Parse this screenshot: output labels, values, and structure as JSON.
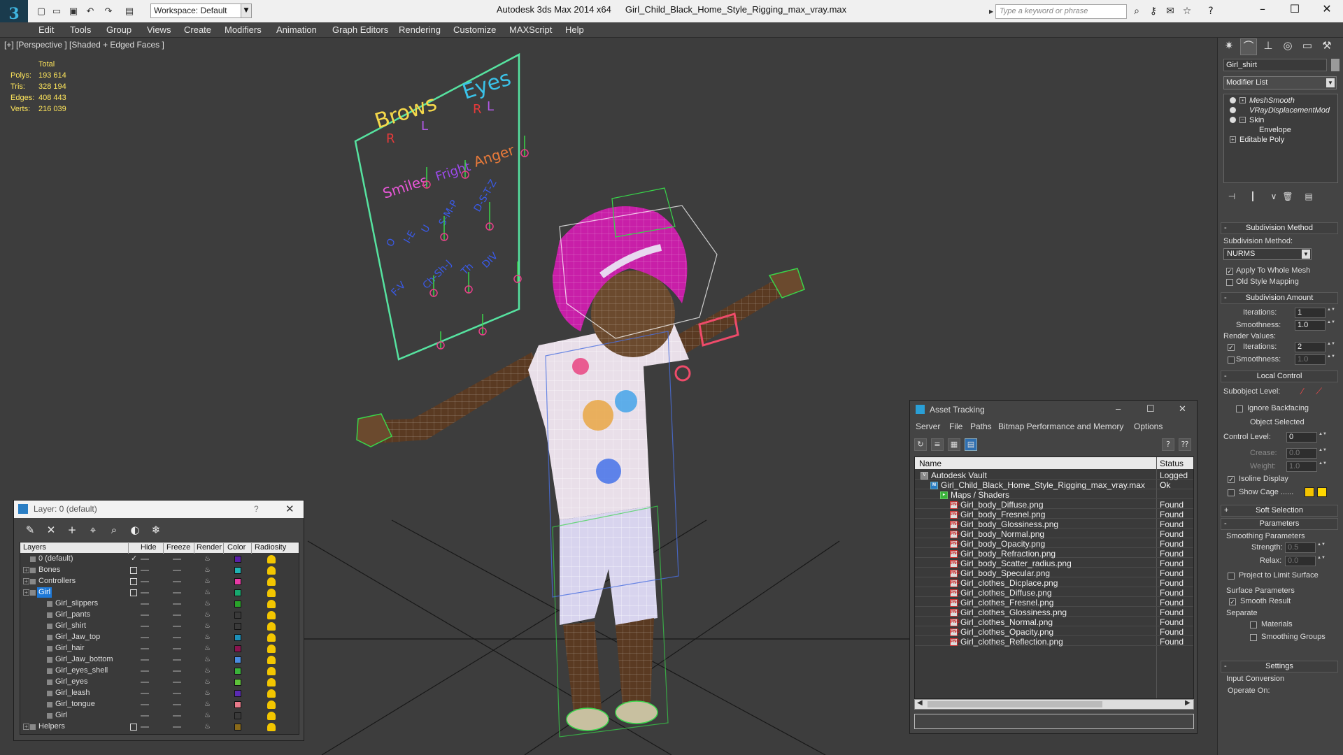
{
  "titlebar": {
    "workspace": "Workspace: Default",
    "app_name": "Autodesk 3ds Max  2014 x64",
    "file_name": "Girl_Child_Black_Home_Style_Rigging_max_vray.max",
    "search_placeholder": "Type a keyword or phrase"
  },
  "menu": [
    "Edit",
    "Tools",
    "Group",
    "Views",
    "Create",
    "Modifiers",
    "Animation",
    "Graph Editors",
    "Rendering",
    "Customize",
    "MAXScript",
    "Help"
  ],
  "viewport": {
    "label": "[+] [Perspective ] [Shaded + Edged Faces ]",
    "stats": {
      "header": "Total",
      "rows": [
        {
          "k": "Polys:",
          "v": "193 614"
        },
        {
          "k": "Tris:",
          "v": "328 194"
        },
        {
          "k": "Edges:",
          "v": "408 443"
        },
        {
          "k": "Verts:",
          "v": "216 039"
        }
      ]
    },
    "face_panel": {
      "brows": "Brows",
      "eyes": "Eyes",
      "r1": "R",
      "l1": "L",
      "r2": "R",
      "l2": "L",
      "smiles": "Smiles",
      "fright": "Fright",
      "anger": "Anger",
      "visemes": [
        "O",
        "I-E",
        "U",
        "S-M-P",
        "D-S-T-Z"
      ],
      "visemes2": [
        "F-V",
        "Ch-Sh-J",
        "Th",
        "DIV"
      ]
    },
    "colors": {
      "stats": "#ffe65c",
      "panel_frame": "#56e3a0",
      "hair": "#c81fa8",
      "wire_green": "#38d64a",
      "wire_blue": "#4a6fe0",
      "pink_ctrl": "#ef4b6a"
    }
  },
  "layer_window": {
    "title": "Layer: 0 (default)",
    "help": "?",
    "columns": [
      "Layers",
      "Hide",
      "Freeze",
      "Render",
      "Color",
      "Radiosity"
    ],
    "rows": [
      {
        "name": "0 (default)",
        "indent": 0,
        "expand": false,
        "check": true,
        "color": "#5a1fa8"
      },
      {
        "name": "Bones",
        "indent": 0,
        "expand": true,
        "color": "#1fb3b3"
      },
      {
        "name": "Controllers",
        "indent": 0,
        "expand": true,
        "color": "#e83aa5"
      },
      {
        "name": "Girl",
        "indent": 0,
        "expand": true,
        "selected": true,
        "color": "#17a86f"
      },
      {
        "name": "Girl_slippers",
        "indent": 1,
        "color": "#2aa32a"
      },
      {
        "name": "Girl_pants",
        "indent": 1,
        "color": "#3a3a3a"
      },
      {
        "name": "Girl_shirt",
        "indent": 1,
        "color": "#3a3a3a"
      },
      {
        "name": "Girl_Jaw_top",
        "indent": 1,
        "color": "#1c8fb8"
      },
      {
        "name": "Girl_hair",
        "indent": 1,
        "color": "#8a1450"
      },
      {
        "name": "Girl_Jaw_bottom",
        "indent": 1,
        "color": "#4a8ce0"
      },
      {
        "name": "Girl_eyes_shell",
        "indent": 1,
        "color": "#3ab33a"
      },
      {
        "name": "Girl_eyes",
        "indent": 1,
        "color": "#5ec23a"
      },
      {
        "name": "Girl_leash",
        "indent": 1,
        "color": "#5a2ab3"
      },
      {
        "name": "Girl_tongue",
        "indent": 1,
        "color": "#e87a8a"
      },
      {
        "name": "Girl",
        "indent": 1,
        "color": "#3a3a3a"
      },
      {
        "name": "Helpers",
        "indent": 0,
        "expand": true,
        "color": "#8a6a1a"
      }
    ]
  },
  "asset_window": {
    "title": "Asset Tracking",
    "menu": [
      "Server",
      "File",
      "Paths",
      "Bitmap Performance and Memory",
      "Options"
    ],
    "columns": [
      "Name",
      "Status"
    ],
    "rows": [
      {
        "name": "Autodesk Vault",
        "status": "Logged O",
        "level": 0,
        "type": "vault"
      },
      {
        "name": "Girl_Child_Black_Home_Style_Rigging_max_vray.max",
        "status": "Ok",
        "level": 1,
        "type": "max"
      },
      {
        "name": "Maps / Shaders",
        "status": "",
        "level": 2,
        "type": "folder"
      },
      {
        "name": "Girl_body_Diffuse.png",
        "status": "Found",
        "level": 3,
        "type": "png"
      },
      {
        "name": "Girl_body_Fresnel.png",
        "status": "Found",
        "level": 3,
        "type": "png"
      },
      {
        "name": "Girl_body_Glossiness.png",
        "status": "Found",
        "level": 3,
        "type": "png"
      },
      {
        "name": "Girl_body_Normal.png",
        "status": "Found",
        "level": 3,
        "type": "png"
      },
      {
        "name": "Girl_body_Opacity.png",
        "status": "Found",
        "level": 3,
        "type": "png"
      },
      {
        "name": "Girl_body_Refraction.png",
        "status": "Found",
        "level": 3,
        "type": "png"
      },
      {
        "name": "Girl_body_Scatter_radius.png",
        "status": "Found",
        "level": 3,
        "type": "png"
      },
      {
        "name": "Girl_body_Specular.png",
        "status": "Found",
        "level": 3,
        "type": "png"
      },
      {
        "name": "Girl_clothes_Dicplace.png",
        "status": "Found",
        "level": 3,
        "type": "png"
      },
      {
        "name": "Girl_clothes_Diffuse.png",
        "status": "Found",
        "level": 3,
        "type": "png"
      },
      {
        "name": "Girl_clothes_Fresnel.png",
        "status": "Found",
        "level": 3,
        "type": "png"
      },
      {
        "name": "Girl_clothes_Glossiness.png",
        "status": "Found",
        "level": 3,
        "type": "png"
      },
      {
        "name": "Girl_clothes_Normal.png",
        "status": "Found",
        "level": 3,
        "type": "png"
      },
      {
        "name": "Girl_clothes_Opacity.png",
        "status": "Found",
        "level": 3,
        "type": "png"
      },
      {
        "name": "Girl_clothes_Reflection.png",
        "status": "Found",
        "level": 3,
        "type": "png"
      }
    ]
  },
  "command_panel": {
    "object_name": "Girl_shirt",
    "modifier_list": "Modifier List",
    "stack": [
      {
        "label": "MeshSmooth",
        "italic": true,
        "eye": true,
        "box": true
      },
      {
        "label": "VRayDisplacementMod",
        "italic": true,
        "eye": true
      },
      {
        "label": "Skin",
        "eye": true,
        "expand": true
      },
      {
        "label": "Envelope",
        "sub": true
      },
      {
        "label": "Editable Poly",
        "box": true
      }
    ],
    "subdivision_method": {
      "rollout": "Subdivision Method",
      "label": "Subdivision Method:",
      "value": "NURMS",
      "apply_whole_mesh": "Apply To Whole Mesh",
      "old_style_mapping": "Old Style Mapping"
    },
    "subdivision_amount": {
      "rollout": "Subdivision Amount",
      "iterations_label": "Iterations:",
      "iterations": "1",
      "smoothness_label": "Smoothness:",
      "smoothness": "1.0",
      "render_values": "Render Values:",
      "r_iterations_label": "Iterations:",
      "r_iterations": "2",
      "r_smoothness_label": "Smoothness:",
      "r_smoothness": "1.0"
    },
    "local_control": {
      "rollout": "Local Control",
      "subobject_level": "Subobject Level:",
      "ignore_backfacing": "Ignore Backfacing",
      "object_selected": "Object Selected",
      "control_level_label": "Control Level:",
      "control_level": "0",
      "crease_label": "Crease:",
      "crease": "0.0",
      "weight_label": "Weight:",
      "weight": "1.0",
      "isoline_display": "Isoline Display",
      "show_cage": "Show Cage ......"
    },
    "soft_selection": {
      "rollout": "Soft Selection"
    },
    "parameters": {
      "rollout": "Parameters",
      "smoothing_params": "Smoothing Parameters",
      "strength_label": "Strength:",
      "strength": "0.5",
      "relax_label": "Relax:",
      "relax": "0.0",
      "project_limit": "Project to Limit Surface",
      "surface_params": "Surface Parameters",
      "smooth_result": "Smooth Result",
      "separate": "Separate",
      "materials": "Materials",
      "smoothing_groups": "Smoothing Groups"
    },
    "settings": {
      "rollout": "Settings",
      "input_conversion": "Input Conversion",
      "operate_on": "Operate On:"
    },
    "cage_colors": [
      "#f5c400",
      "#ffd800"
    ]
  }
}
